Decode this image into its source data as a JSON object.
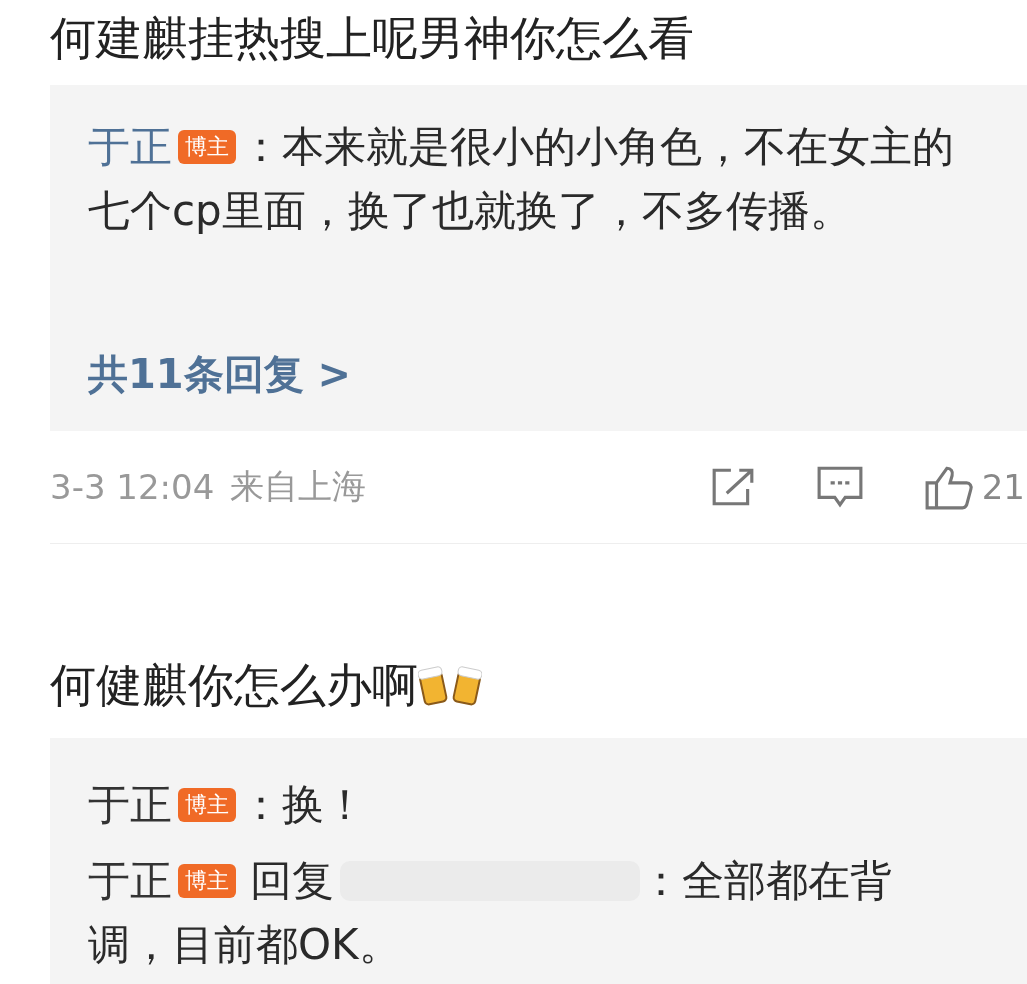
{
  "comments": [
    {
      "text": "何建麒挂热搜上呢男神你怎么看",
      "replies": [
        {
          "name": "于正",
          "badge": "博主",
          "name_highlight": true,
          "text_lines": [
            "：本来就是很小的小角色，不在女主的",
            "七个cp里面，换了也就换了，不多传播。"
          ]
        }
      ],
      "more_replies": "共11条回复 >",
      "time": "3-3 12:04",
      "location": "来自上海",
      "likes": "21"
    },
    {
      "text": "何健麒你怎么办啊",
      "emoji": true,
      "replies": [
        {
          "name": "于正",
          "badge": "博主",
          "name_highlight": false,
          "text_lines": [
            "：换！"
          ]
        },
        {
          "name": "于正",
          "badge": "博主",
          "name_highlight": false,
          "prefix": "回复",
          "hidden_user": true,
          "text_lines": [
            "：全部都在背",
            "调，目前都OK。"
          ]
        }
      ]
    }
  ]
}
